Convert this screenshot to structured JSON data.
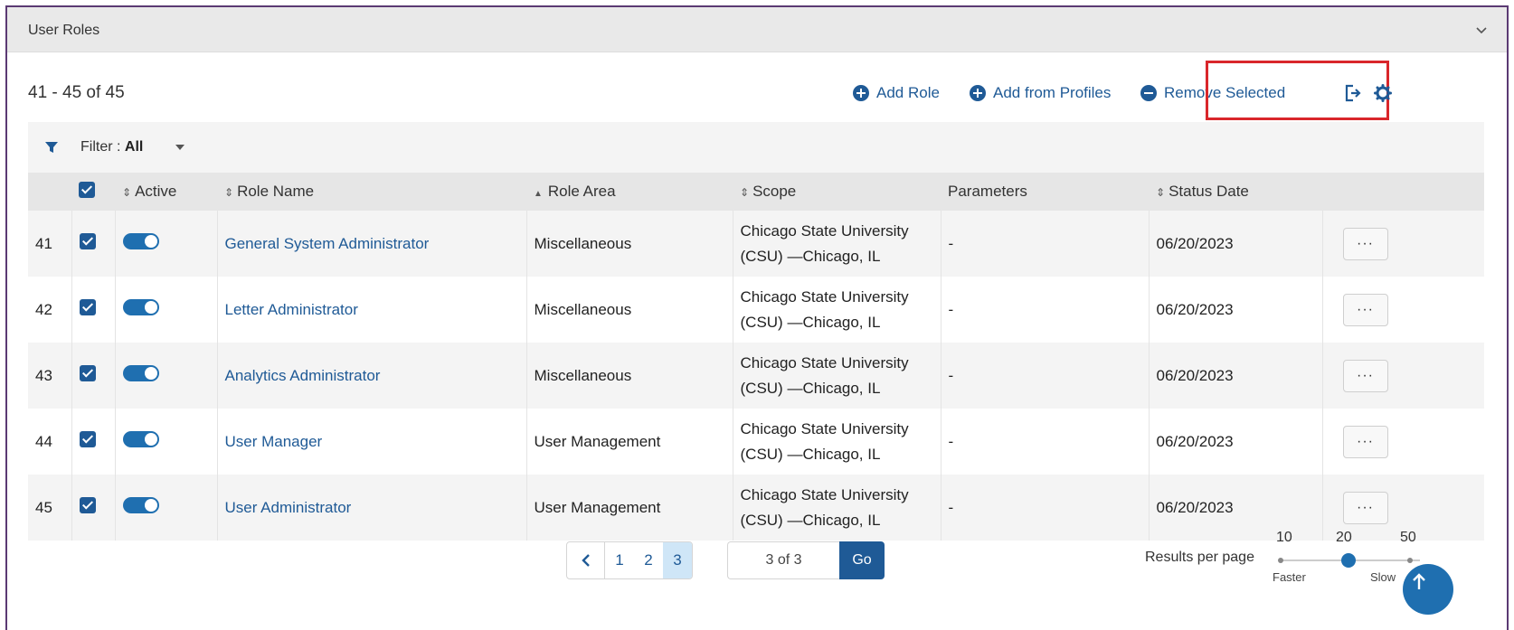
{
  "section": {
    "title": "User Roles",
    "collapse_icon": "chevron-down-icon"
  },
  "count_label": "41 - 45 of 45",
  "toolbar": {
    "add_role": "Add Role",
    "add_from_profiles": "Add from Profiles",
    "remove_selected": "Remove Selected",
    "export_icon": "export-icon",
    "settings_icon": "gear-icon"
  },
  "filter": {
    "label": "Filter :",
    "value": "All"
  },
  "columns": {
    "active": "Active",
    "role_name": "Role Name",
    "role_area": "Role Area",
    "scope": "Scope",
    "parameters": "Parameters",
    "status_date": "Status Date"
  },
  "rows": [
    {
      "num": "41",
      "role_name": "General System Administrator",
      "role_area": "Miscellaneous",
      "scope_line1": "Chicago State University",
      "scope_line2": "(CSU) —Chicago, IL",
      "parameters": "-",
      "status_date": "06/20/2023",
      "more": "···"
    },
    {
      "num": "42",
      "role_name": "Letter Administrator",
      "role_area": "Miscellaneous",
      "scope_line1": "Chicago State University",
      "scope_line2": "(CSU) —Chicago, IL",
      "parameters": "-",
      "status_date": "06/20/2023",
      "more": "···"
    },
    {
      "num": "43",
      "role_name": "Analytics Administrator",
      "role_area": "Miscellaneous",
      "scope_line1": "Chicago State University",
      "scope_line2": "(CSU) —Chicago, IL",
      "parameters": "-",
      "status_date": "06/20/2023",
      "more": "···"
    },
    {
      "num": "44",
      "role_name": "User Manager",
      "role_area": "User Management",
      "scope_line1": "Chicago State University",
      "scope_line2": "(CSU) —Chicago, IL",
      "parameters": "-",
      "status_date": "06/20/2023",
      "more": "···"
    },
    {
      "num": "45",
      "role_name": "User Administrator",
      "role_area": "User Management",
      "scope_line1": "Chicago State University",
      "scope_line2": "(CSU) —Chicago, IL",
      "parameters": "-",
      "status_date": "06/20/2023",
      "more": "···"
    }
  ],
  "pagination": {
    "pages": [
      "1",
      "2",
      "3"
    ],
    "current": "3",
    "goto_value": "3 of 3",
    "go_label": "Go"
  },
  "results_per_page": {
    "label": "Results per page",
    "options": [
      "10",
      "20",
      "50"
    ],
    "selected": "20",
    "faster": "Faster",
    "slower": "Slow"
  },
  "colors": {
    "brand_blue": "#1f5a96",
    "highlight_red": "#d9262b",
    "frame_purple": "#5b3a73"
  }
}
